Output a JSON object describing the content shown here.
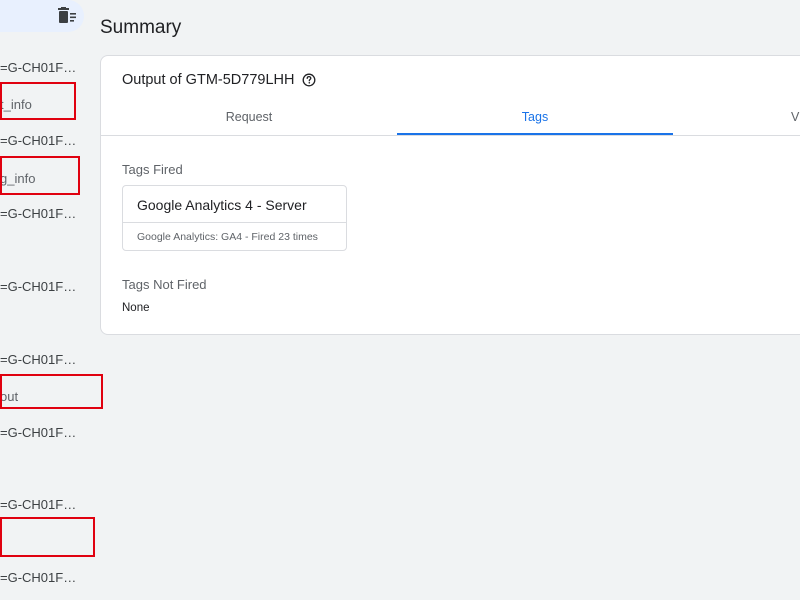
{
  "sidebar": {
    "items": [
      {
        "label": "=G-CH01F…",
        "kind": "request"
      },
      {
        "label": "t_info",
        "kind": "event"
      },
      {
        "label": "=G-CH01F…",
        "kind": "request"
      },
      {
        "label": "g_info",
        "kind": "event"
      },
      {
        "label": "=G-CH01F…",
        "kind": "request"
      },
      {
        "label": "=G-CH01F…",
        "kind": "request"
      },
      {
        "label": "=G-CH01F…",
        "kind": "request"
      },
      {
        "label": "out",
        "kind": "event"
      },
      {
        "label": "=G-CH01F…",
        "kind": "request"
      },
      {
        "label": "=G-CH01F…",
        "kind": "request"
      },
      {
        "label": "=G-CH01F…",
        "kind": "request"
      }
    ]
  },
  "page": {
    "title": "Summary"
  },
  "output": {
    "title": "Output of GTM-5D779LHH",
    "tabs": [
      {
        "label": "Request",
        "active": false
      },
      {
        "label": "Tags",
        "active": true
      },
      {
        "label": "V",
        "active": false
      }
    ]
  },
  "tags_fired": {
    "label": "Tags Fired",
    "items": [
      {
        "name": "Google Analytics 4 - Server",
        "meta": "Google Analytics: GA4 - Fired 23 times"
      }
    ]
  },
  "tags_not_fired": {
    "label": "Tags Not Fired",
    "value": "None"
  },
  "colors": {
    "accent": "#1a73e8",
    "highlight": "#e0000f",
    "selected_bg": "#e8f0fe"
  },
  "icons": {
    "clear": "trash-list-icon",
    "help": "help-circle-icon"
  }
}
